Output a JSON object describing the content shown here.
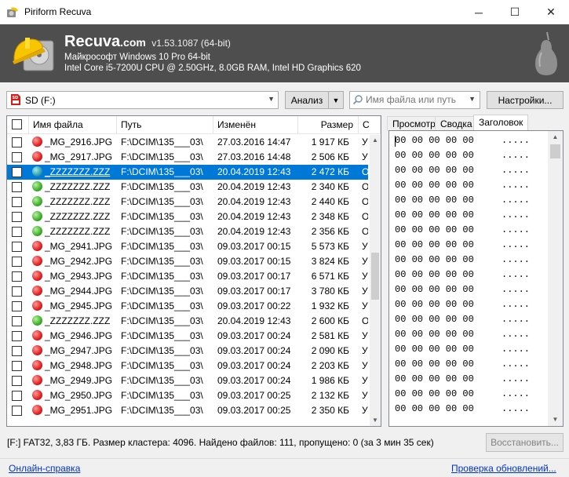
{
  "window": {
    "title": "Piriform Recuva",
    "controls": {
      "minimize": "─",
      "maximize": "☐",
      "close": "✕"
    }
  },
  "header": {
    "brand": "Recuva",
    "brand_suffix": ".com",
    "version": "v1.53.1087 (64-bit)",
    "os_line": "Майкрософт Windows 10 Pro 64-bit",
    "hw_line": "Intel Core i5-7200U CPU @ 2.50GHz, 8.0GB RAM, Intel HD Graphics 620"
  },
  "toolbar": {
    "drive": "SD (F:)",
    "scan_label": "Анализ",
    "search_placeholder": "Имя файла или путь",
    "settings_label": "Настройки..."
  },
  "table": {
    "columns": {
      "name": "Имя файла",
      "path": "Путь",
      "modified": "Изменён",
      "size": "Размер",
      "state": "С"
    },
    "rows": [
      {
        "status": "red",
        "name": "_MG_2916.JPG",
        "path": "F:\\DCIM\\135___03\\",
        "modified": "27.03.2016 14:47",
        "size": "1 917 КБ",
        "state": "У",
        "selected": false
      },
      {
        "status": "red",
        "name": "_MG_2917.JPG",
        "path": "F:\\DCIM\\135___03\\",
        "modified": "27.03.2016 14:48",
        "size": "2 506 КБ",
        "state": "У",
        "selected": false
      },
      {
        "status": "teal",
        "name": "_ZZZZZZZ.ZZZ",
        "path": "F:\\DCIM\\135___03\\",
        "modified": "20.04.2019 12:43",
        "size": "2 472 КБ",
        "state": "О",
        "selected": true
      },
      {
        "status": "green",
        "name": "_ZZZZZZZ.ZZZ",
        "path": "F:\\DCIM\\135___03\\",
        "modified": "20.04.2019 12:43",
        "size": "2 340 КБ",
        "state": "О",
        "selected": false
      },
      {
        "status": "green",
        "name": "_ZZZZZZZ.ZZZ",
        "path": "F:\\DCIM\\135___03\\",
        "modified": "20.04.2019 12:43",
        "size": "2 440 КБ",
        "state": "О",
        "selected": false
      },
      {
        "status": "green",
        "name": "_ZZZZZZZ.ZZZ",
        "path": "F:\\DCIM\\135___03\\",
        "modified": "20.04.2019 12:43",
        "size": "2 348 КБ",
        "state": "О",
        "selected": false
      },
      {
        "status": "green",
        "name": "_ZZZZZZZ.ZZZ",
        "path": "F:\\DCIM\\135___03\\",
        "modified": "20.04.2019 12:43",
        "size": "2 356 КБ",
        "state": "О",
        "selected": false
      },
      {
        "status": "red",
        "name": "_MG_2941.JPG",
        "path": "F:\\DCIM\\135___03\\",
        "modified": "09.03.2017 00:15",
        "size": "5 573 КБ",
        "state": "У",
        "selected": false
      },
      {
        "status": "red",
        "name": "_MG_2942.JPG",
        "path": "F:\\DCIM\\135___03\\",
        "modified": "09.03.2017 00:15",
        "size": "3 824 КБ",
        "state": "У",
        "selected": false
      },
      {
        "status": "red",
        "name": "_MG_2943.JPG",
        "path": "F:\\DCIM\\135___03\\",
        "modified": "09.03.2017 00:17",
        "size": "6 571 КБ",
        "state": "У",
        "selected": false
      },
      {
        "status": "red",
        "name": "_MG_2944.JPG",
        "path": "F:\\DCIM\\135___03\\",
        "modified": "09.03.2017 00:17",
        "size": "3 780 КБ",
        "state": "У",
        "selected": false
      },
      {
        "status": "red",
        "name": "_MG_2945.JPG",
        "path": "F:\\DCIM\\135___03\\",
        "modified": "09.03.2017 00:22",
        "size": "1 932 КБ",
        "state": "У",
        "selected": false
      },
      {
        "status": "green",
        "name": "_ZZZZZZZ.ZZZ",
        "path": "F:\\DCIM\\135___03\\",
        "modified": "20.04.2019 12:43",
        "size": "2 600 КБ",
        "state": "О",
        "selected": false
      },
      {
        "status": "red",
        "name": "_MG_2946.JPG",
        "path": "F:\\DCIM\\135___03\\",
        "modified": "09.03.2017 00:24",
        "size": "2 581 КБ",
        "state": "У",
        "selected": false
      },
      {
        "status": "red",
        "name": "_MG_2947.JPG",
        "path": "F:\\DCIM\\135___03\\",
        "modified": "09.03.2017 00:24",
        "size": "2 090 КБ",
        "state": "У",
        "selected": false
      },
      {
        "status": "red",
        "name": "_MG_2948.JPG",
        "path": "F:\\DCIM\\135___03\\",
        "modified": "09.03.2017 00:24",
        "size": "2 203 КБ",
        "state": "У",
        "selected": false
      },
      {
        "status": "red",
        "name": "_MG_2949.JPG",
        "path": "F:\\DCIM\\135___03\\",
        "modified": "09.03.2017 00:24",
        "size": "1 986 КБ",
        "state": "У",
        "selected": false
      },
      {
        "status": "red",
        "name": "_MG_2950.JPG",
        "path": "F:\\DCIM\\135___03\\",
        "modified": "09.03.2017 00:25",
        "size": "2 132 КБ",
        "state": "У",
        "selected": false
      },
      {
        "status": "red",
        "name": "_MG_2951.JPG",
        "path": "F:\\DCIM\\135___03\\",
        "modified": "09.03.2017 00:25",
        "size": "2 350 КБ",
        "state": "У",
        "selected": false
      }
    ]
  },
  "right_pane": {
    "tabs": [
      "Просмотр",
      "Сводка",
      "Заголовок"
    ],
    "active_tab": 2,
    "hex_bytes": "00 00 00 00 00",
    "hex_ascii": ".....",
    "hex_line_count": 19
  },
  "status": {
    "text": "[F:] FAT32, 3,83 ГБ. Размер кластера: 4096. Найдено файлов: 111, пропущено: 0 (за 3 мин 35 сек)",
    "restore_label": "Восстановить..."
  },
  "footer": {
    "help_link": "Онлайн-справка",
    "update_link": "Проверка обновлений..."
  },
  "colors": {
    "header_bg": "#4e4e4e",
    "selection": "#0078d7",
    "link": "#0033cc",
    "status_red": "#e02020",
    "status_green": "#3eae2a",
    "status_teal": "#2e9fb0"
  }
}
